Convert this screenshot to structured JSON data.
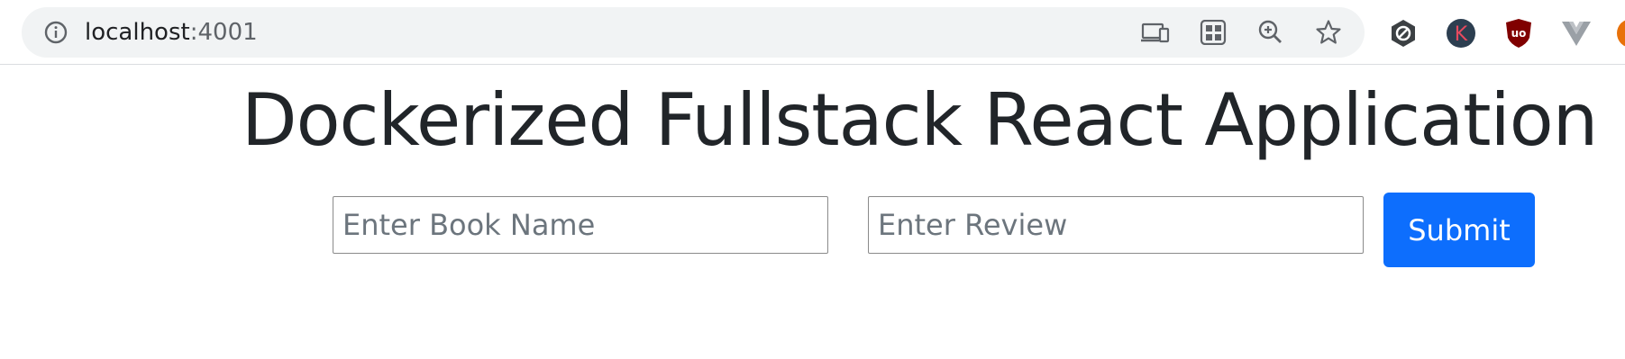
{
  "browser": {
    "url_host": "localhost",
    "url_port": ":4001",
    "omnibox_icons": [
      "install-app-icon",
      "qr-code-icon",
      "zoom-icon",
      "bookmark-star-icon"
    ],
    "extension_icons": [
      "hexagon-extension-icon",
      "k-extension-icon",
      "ublock-origin-icon",
      "vue-devtools-icon",
      "orange-extension-icon"
    ]
  },
  "page": {
    "title": "Dockerized Fullstack React Application",
    "book_name_input": {
      "placeholder": "Enter Book Name",
      "value": ""
    },
    "review_input": {
      "placeholder": "Enter Review",
      "value": ""
    },
    "submit_label": "Submit"
  },
  "colors": {
    "primary": "#0d6efd",
    "title": "#212529",
    "omnibox_bg": "#f1f3f4"
  }
}
